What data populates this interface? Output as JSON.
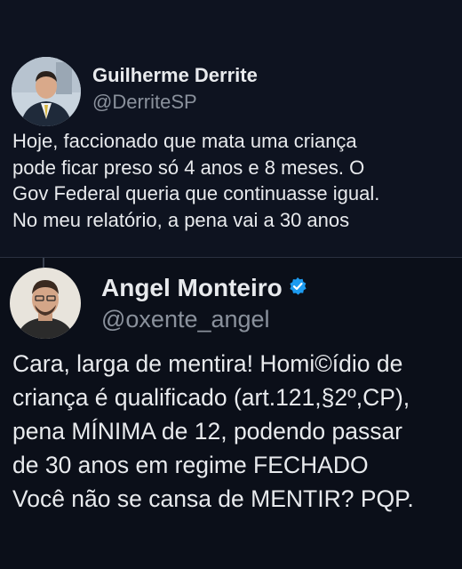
{
  "tweets": [
    {
      "display_name": "Guilherme Derrite",
      "handle": "@DerriteSP",
      "verified": false,
      "lines": [
        "Hoje, faccionado que mata uma criança",
        "pode ficar preso só 4 anos e 8 meses. O",
        "Gov Federal queria que continuasse igual.",
        "No meu relatório, a pena vai a 30 anos"
      ]
    },
    {
      "display_name": "Angel Monteiro",
      "handle": "@oxente_angel",
      "verified": true,
      "lines": [
        "Cara, larga de mentira! Homi©ídio de",
        "criança é qualificado (art.121,§2º,CP),",
        "pena MÍNIMA de 12, podendo passar",
        "de 30 anos em regime FECHADO",
        "Você não se cansa de MENTIR? PQP."
      ]
    }
  ],
  "icons": {
    "verified_badge": "verified-badge-icon"
  },
  "colors": {
    "background": "#0b0f19",
    "handle_text": "#8a919c",
    "verified": "#1d9bf0"
  }
}
